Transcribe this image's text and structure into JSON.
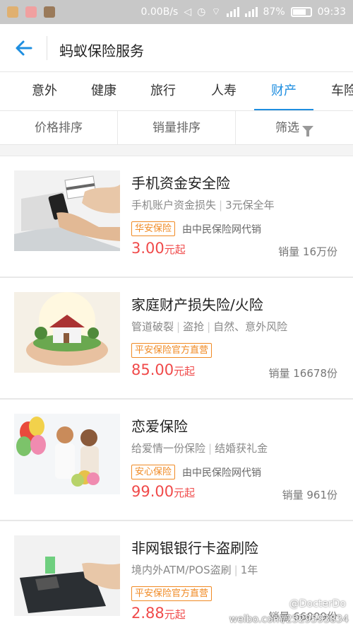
{
  "status": {
    "speed": "0.00B/s",
    "battery": "87%",
    "time": "09:33"
  },
  "header": {
    "title": "蚂蚁保险服务"
  },
  "tabs": [
    {
      "label": "意外"
    },
    {
      "label": "健康"
    },
    {
      "label": "旅行"
    },
    {
      "label": "人寿"
    },
    {
      "label": "财产",
      "active": true
    },
    {
      "label": "车险"
    }
  ],
  "sort": {
    "price": "价格排序",
    "sales": "销量排序",
    "filter": "筛选"
  },
  "products": [
    {
      "name": "手机资金安全险",
      "desc1": "手机账户资金损失",
      "desc2": "3元保全年",
      "desc3": "",
      "tag": "华安保险",
      "seller": "由中民保险网代销",
      "price": "3.00",
      "unit": "元起",
      "sales": "销量 16万份"
    },
    {
      "name": "家庭财产损失险/火险",
      "desc1": "管道破裂",
      "desc2": "盗抢",
      "desc3": "自然、意外风险",
      "tag": "平安保险官方直营",
      "seller": "",
      "price": "85.00",
      "unit": "元起",
      "sales": "销量 16678份"
    },
    {
      "name": "恋爱保险",
      "desc1": "给爱情一份保险",
      "desc2": "结婚获礼金",
      "desc3": "",
      "tag": "安心保险",
      "seller": "由中民保险网代销",
      "price": "99.00",
      "unit": "元起",
      "sales": "销量 961份"
    },
    {
      "name": "非网银银行卡盗刷险",
      "desc1": "境内外ATM/POS盗刷",
      "desc2": "1年",
      "desc3": "",
      "tag": "平安保险官方直营",
      "seller": "",
      "price": "2.88",
      "unit": "元起",
      "sales": "销量 66009份"
    }
  ],
  "watermark": {
    "handle": "@DocterDo",
    "url": "weibo.com/2529593834"
  },
  "colors": {
    "accent": "#1e8ee0",
    "price": "#f04a4a",
    "tag": "#f08a24"
  }
}
